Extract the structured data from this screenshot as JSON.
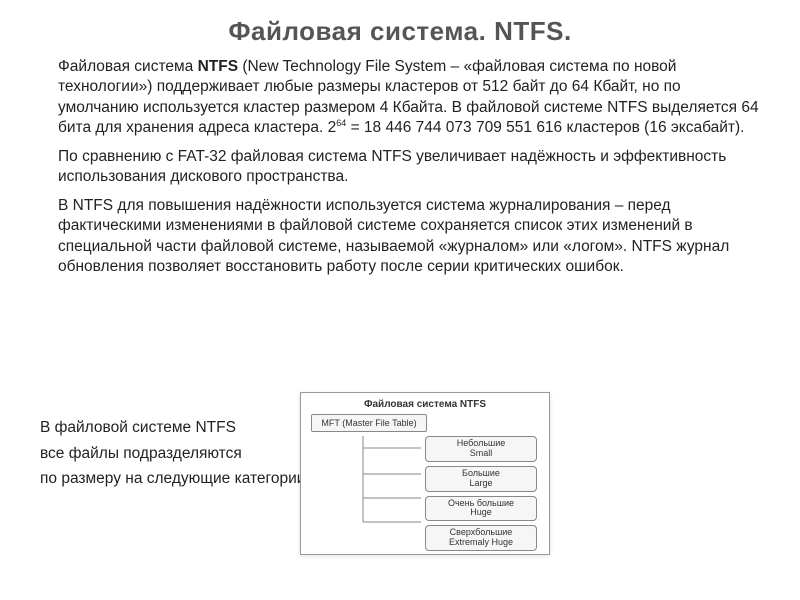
{
  "title": "Файловая система. NTFS.",
  "para1_a": "Файловая система ",
  "para1_bold": "NTFS",
  "para1_b": " (New Technology File System – «файловая система по новой технологии») поддерживает любые размеры кластеров от 512 байт до 64 Кбайт, но по умолчанию используется кластер размером 4 Кбайта. В файловой системе NTFS выделяется 64 бита для хранения адреса кластера. 2",
  "para1_sup": "64",
  "para1_c": " = 18 446 744 073 709 551 616 кластеров (16 эксабайт).",
  "para2": "По сравнению с FAT-32 файловая система NTFS увеличивает надёжность и эффективность использования дискового пространства.",
  "para3": "В NTFS для повышения надёжности используется система журналирования – перед фактическими изменениями в файловой системе сохраняется список этих изменений в специальной части файловой системе, называемой «журналом» или «логом». NTFS журнал обновления позволяет восстановить работу после серии критических ошибок.",
  "overlap1": "В файловой системе NTFS",
  "overlap2": "все файлы подразделяются",
  "overlap3": "по размеру на следующие категории:",
  "diagram": {
    "title": "Файловая система NTFS",
    "mft": "MFT (Master File Table)",
    "categories": [
      "Небольшие\nSmall",
      "Большие\nLarge",
      "Очень большие\nHuge",
      "Сверхбольшие\nExtremaly Huge"
    ]
  }
}
